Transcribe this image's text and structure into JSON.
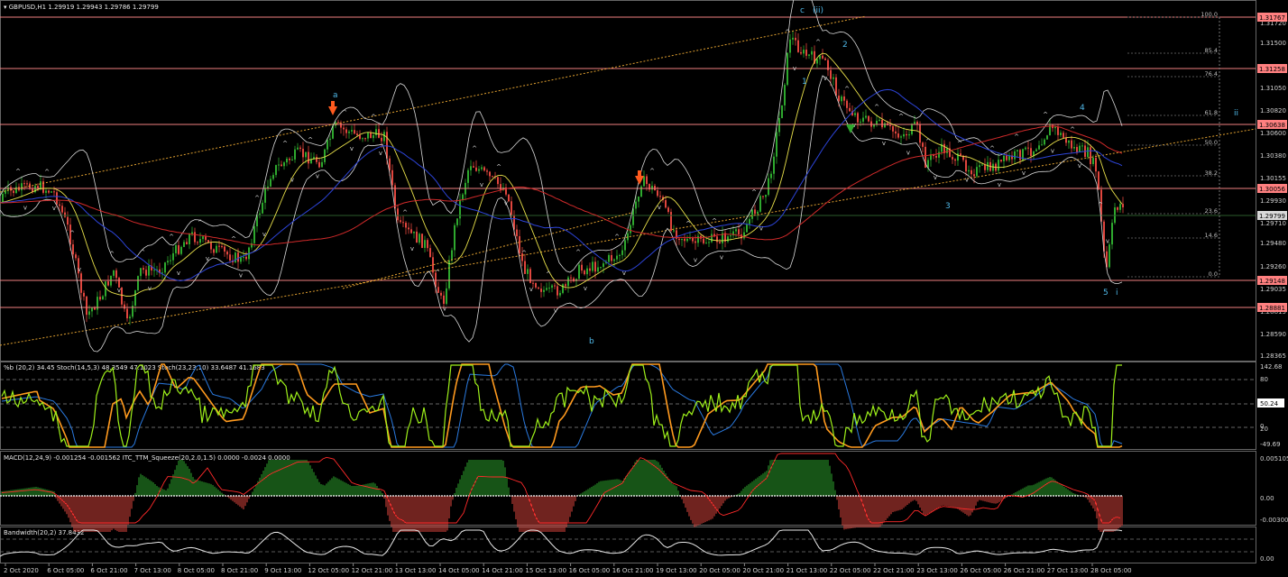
{
  "header": {
    "main": "GBPUSD,H1  1.29919 1.29943 1.29786 1.29799",
    "stoch": "%b (20,2) 34.45   Stoch(14,5,3) 48.3549 47.1023   Stoch(23,23,10) 33.6487 41.1683",
    "macd": "MACD(12,24,9) -0.001254 -0.001562   ITC_TTM_Squeeze(20,2.0,1.5) 0.0000 -0.0024 0.0000",
    "bandwidth": "Bandwidth(20,2) 37.8432"
  },
  "price_axis": [
    "1.31720",
    "1.31500",
    "1.31050",
    "1.30820",
    "1.30600",
    "1.30380",
    "1.30155",
    "1.29930",
    "1.29710",
    "1.29480",
    "1.29260",
    "1.29035",
    "1.28815",
    "1.28590",
    "1.28365"
  ],
  "price_tags": [
    {
      "text": "1.31767",
      "color": "#ff8080"
    },
    {
      "text": "1.31258",
      "color": "#ff8080"
    },
    {
      "text": "1.30638",
      "color": "#ff8080"
    },
    {
      "text": "1.30056",
      "color": "#ff8080"
    },
    {
      "text": "1.29799",
      "color": "#d8d8d8"
    },
    {
      "text": "1.29148",
      "color": "#ff8080"
    },
    {
      "text": "1.28881",
      "color": "#ff8080"
    }
  ],
  "fib_levels": [
    "100.0",
    "85.4",
    "76.4",
    "61.8",
    "50.0",
    "38.2",
    "23.6",
    "14.6",
    "0.0"
  ],
  "wave_labels": [
    "a",
    "b",
    "c",
    "(ii)",
    "1",
    "2",
    "3",
    "4",
    "5",
    "i",
    "ii"
  ],
  "stoch_axis": [
    "142.68",
    "80",
    "50.24",
    "20",
    "0",
    "-49.69"
  ],
  "macd_axis": [
    "0.005105",
    "0.00",
    "-0.003008"
  ],
  "bw_axis": [
    "0.00"
  ],
  "time_axis": [
    "2 Oct 2020",
    "6 Oct 05:00",
    "6 Oct 21:00",
    "7 Oct 13:00",
    "8 Oct 05:00",
    "8 Oct 21:00",
    "9 Oct 13:00",
    "12 Oct 05:00",
    "12 Oct 21:00",
    "13 Oct 13:00",
    "14 Oct 05:00",
    "14 Oct 21:00",
    "15 Oct 13:00",
    "16 Oct 05:00",
    "16 Oct 21:00",
    "19 Oct 13:00",
    "20 Oct 05:00",
    "20 Oct 21:00",
    "21 Oct 13:00",
    "22 Oct 05:00",
    "22 Oct 21:00",
    "23 Oct 13:00",
    "26 Oct 05:00",
    "26 Oct 21:00",
    "27 Oct 13:00",
    "28 Oct 05:00"
  ],
  "colors": {
    "bull": "#2ea82e",
    "bear": "#e0463e",
    "hline": "#f08080",
    "ma_slow": "#d02a2a",
    "ma_mid": "#2d44d8",
    "ma_fast": "#e8e04a",
    "bb": "#d8d8d8",
    "channel": "#e0a030",
    "arrow": "#ff5a1e",
    "stoch_fast": "#9ef01a",
    "stoch_slow": "#ff9a1e",
    "stoch_blue": "#2a7ae0"
  }
}
